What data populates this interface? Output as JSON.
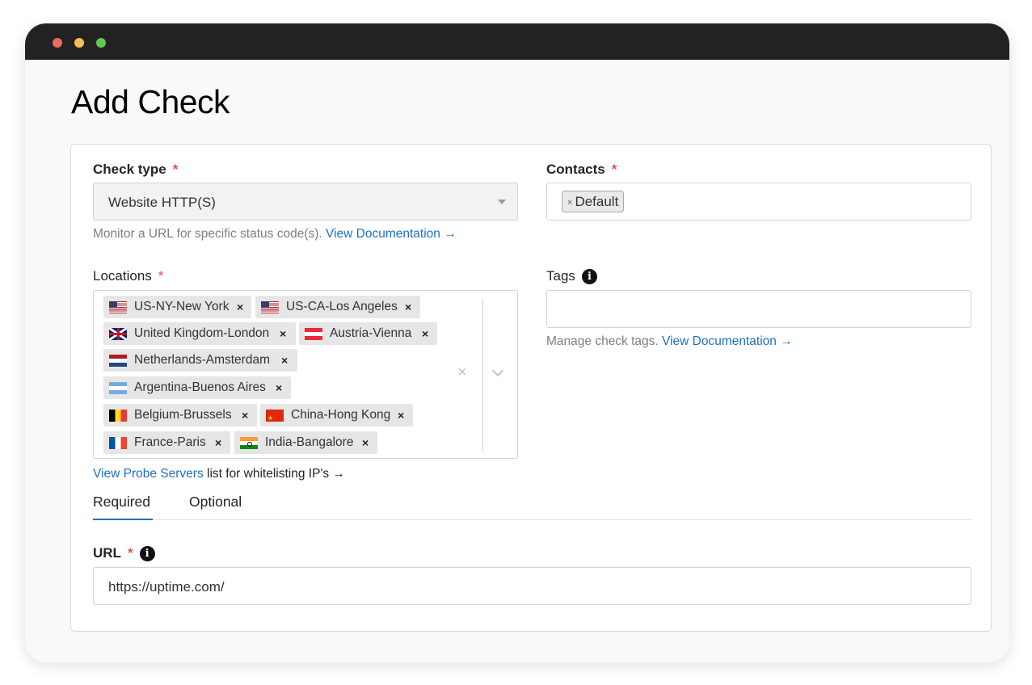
{
  "page_title": "Add Check",
  "check_type": {
    "label": "Check type",
    "required_mark": "*",
    "value": "Website HTTP(S)",
    "help_text": "Monitor a URL for specific status code(s).",
    "help_link": "View Documentation →"
  },
  "contacts": {
    "label": "Contacts",
    "required_mark": "*",
    "chips": [
      {
        "remove": "×",
        "label": "Default"
      }
    ]
  },
  "locations": {
    "label": "Locations",
    "required_mark": "*",
    "chips": [
      {
        "label": "US-NY-New York",
        "flag": "us-flag-icon"
      },
      {
        "label": "US-CA-Los Angeles",
        "flag": "us-flag-icon"
      },
      {
        "label": "United Kingdom-London",
        "flag": "uk-flag-icon"
      },
      {
        "label": "Austria-Vienna",
        "flag": "austria-flag-icon"
      },
      {
        "label": "Netherlands-Amsterdam",
        "flag": "netherlands-flag-icon"
      },
      {
        "label": "Argentina-Buenos Aires",
        "flag": "argentina-flag-icon"
      },
      {
        "label": "Belgium-Brussels",
        "flag": "belgium-flag-icon"
      },
      {
        "label": "China-Hong Kong",
        "flag": "hong-kong-flag-icon"
      },
      {
        "label": "France-Paris",
        "flag": "france-flag-icon"
      },
      {
        "label": "India-Bangalore",
        "flag": "india-flag-icon"
      }
    ],
    "chip_remove": "×",
    "clear_all": "×",
    "probe_link": "View Probe Servers",
    "probe_text": " list for whitelisting IP's →"
  },
  "tags": {
    "label": "Tags",
    "info_icon": "i",
    "value": "",
    "help_text": "Manage check tags.",
    "help_link": "View Documentation →"
  },
  "tabs": [
    {
      "label": "Required",
      "active": true
    },
    {
      "label": "Optional",
      "active": false
    }
  ],
  "url": {
    "label": "URL",
    "required_mark": "*",
    "info_icon": "i",
    "value": "https://uptime.com/"
  },
  "colors": {
    "link": "#1f6fc5",
    "required": "#d9534f",
    "titlebar": "#222222"
  }
}
